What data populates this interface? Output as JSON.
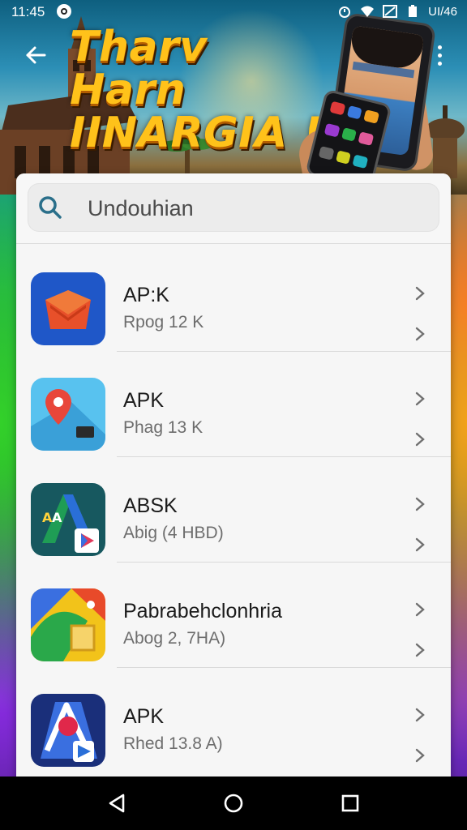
{
  "status_bar": {
    "time": "11:45",
    "right_label": "UI/46"
  },
  "hero": {
    "title_line1": "Tharv Harn",
    "title_line2": "IINARGIA !"
  },
  "search": {
    "placeholder": "Undouhian"
  },
  "apps": [
    {
      "title": "AP:K",
      "subtitle": "Rpog 12 K",
      "icon": "red-envelope-box-icon"
    },
    {
      "title": "APK",
      "subtitle": "Phag 13 K",
      "icon": "map-pin-icon"
    },
    {
      "title": "ABSK",
      "subtitle": "Abig (4 HBD)",
      "icon": "play-store-style-icon"
    },
    {
      "title": "Pabrabehclonhria",
      "subtitle": "Abog 2, 7HA)",
      "icon": "colorful-folder-icon"
    },
    {
      "title": "APK",
      "subtitle": "Rhed 13.8 A)",
      "icon": "abstract-play-icon"
    }
  ],
  "colors": {
    "card_bg": "#f6f6f6",
    "title_text": "#1b1b1b",
    "subtitle_text": "#6d6d6d",
    "hero_title": "#ffc21a",
    "search_icon": "#2a6f8a"
  },
  "icons": {
    "back": "arrow-left-icon",
    "menu": "more-vertical-icon",
    "search": "search-icon",
    "chevron": "chevron-right-icon"
  }
}
